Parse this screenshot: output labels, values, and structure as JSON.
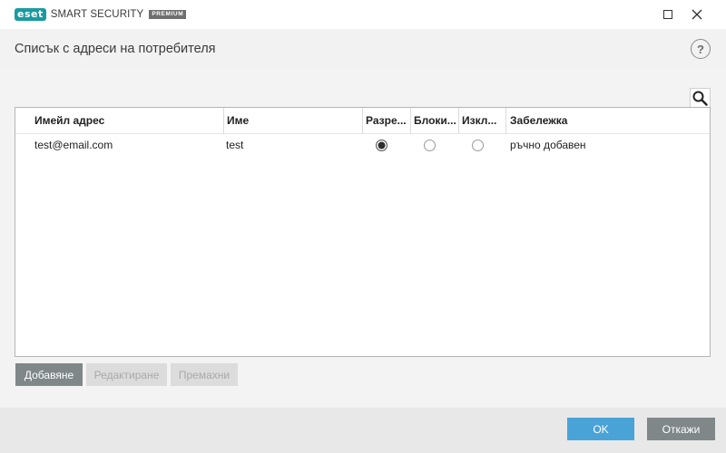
{
  "app": {
    "brand_badge": "eset",
    "product_name": "SMART SECURITY",
    "edition": "PREMIUM"
  },
  "header": {
    "title": "Списък с адреси на потребителя",
    "help_label": "?"
  },
  "table": {
    "columns": {
      "email": "Имейл адрес",
      "name": "Име",
      "allowed": "Разре...",
      "blocked": "Блоки...",
      "excluded": "Изкл...",
      "note": "Забележка"
    },
    "rows": [
      {
        "email": "test@email.com",
        "name": "test",
        "selected": "allowed",
        "note": "ръчно добавен"
      }
    ]
  },
  "actions": {
    "add": "Добавяне",
    "edit": "Редактиране",
    "remove": "Премахни"
  },
  "footer": {
    "ok": "OK",
    "cancel": "Откажи"
  },
  "colors": {
    "accent": "#4aa3d7",
    "brand": "#1a9aa0",
    "neutral_button": "#7f8789"
  },
  "icons": {
    "search": "search-icon",
    "help": "help-icon",
    "maximize": "maximize-icon",
    "close": "close-icon"
  }
}
